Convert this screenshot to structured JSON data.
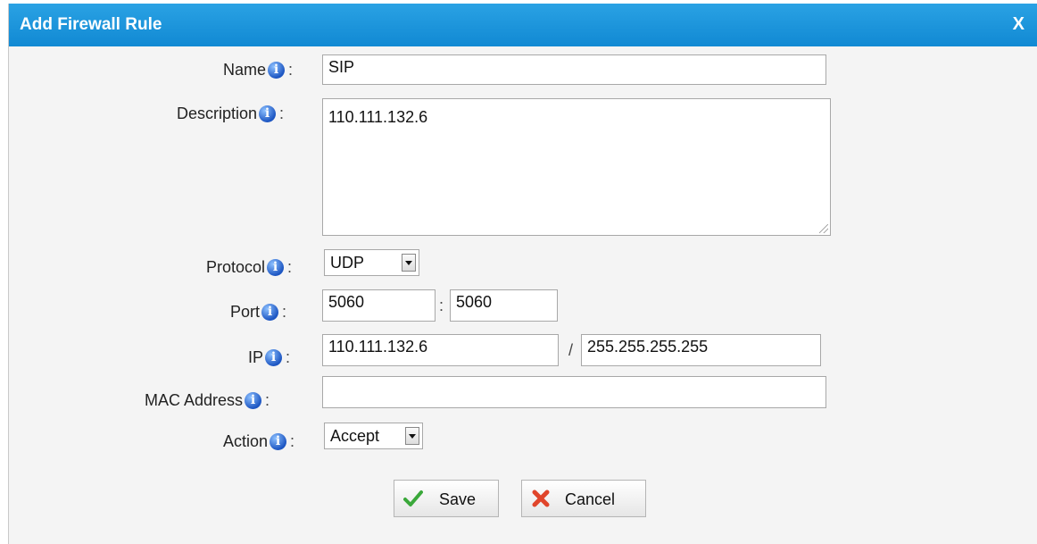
{
  "dialog": {
    "title": "Add Firewall Rule",
    "close_label": "X"
  },
  "fields": {
    "name": {
      "label": "Name",
      "value": "SIP"
    },
    "description": {
      "label": "Description",
      "value": "110.111.132.6"
    },
    "protocol": {
      "label": "Protocol",
      "selected": "UDP"
    },
    "port": {
      "label": "Port",
      "from": "5060",
      "separator": ":",
      "to": "5060"
    },
    "ip": {
      "label": "IP",
      "address": "110.111.132.6",
      "separator": "/",
      "mask": "255.255.255.255"
    },
    "mac": {
      "label": "MAC Address",
      "value": ""
    },
    "action": {
      "label": "Action",
      "selected": "Accept"
    }
  },
  "info_glyph": "i",
  "colon": ":",
  "buttons": {
    "save": "Save",
    "cancel": "Cancel"
  },
  "colors": {
    "titlebar": "#1a92dc",
    "background": "#f4f4f4",
    "save_icon": "#3aa83a",
    "cancel_icon": "#e0452b"
  }
}
